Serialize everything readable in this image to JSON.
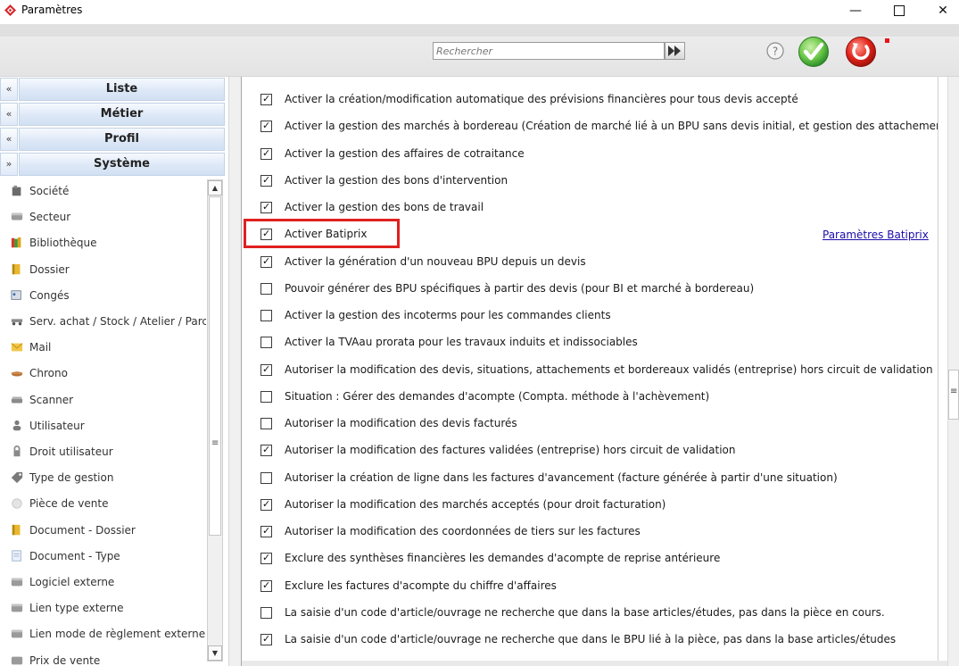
{
  "window": {
    "title": "Paramètres",
    "minimize_label": "—",
    "close_label": "✕"
  },
  "toolbar": {
    "search_placeholder": "Rechercher"
  },
  "sidebar": {
    "sections": [
      {
        "label": "Liste",
        "toggle": "«"
      },
      {
        "label": "Métier",
        "toggle": "«"
      },
      {
        "label": "Profil",
        "toggle": "«"
      },
      {
        "label": "Système",
        "toggle": "»"
      }
    ],
    "items": [
      {
        "label": "Société",
        "icon": "building-icon"
      },
      {
        "label": "Secteur",
        "icon": "sector-icon"
      },
      {
        "label": "Bibliothèque",
        "icon": "books-icon"
      },
      {
        "label": "Dossier",
        "icon": "folder-icon"
      },
      {
        "label": "Congés",
        "icon": "calendar-icon"
      },
      {
        "label": "Serv. achat / Stock / Atelier / Parc",
        "icon": "truck-icon"
      },
      {
        "label": "Mail",
        "icon": "mail-icon"
      },
      {
        "label": "Chrono",
        "icon": "chrono-icon"
      },
      {
        "label": "Scanner",
        "icon": "scanner-icon"
      },
      {
        "label": "Utilisateur",
        "icon": "user-icon"
      },
      {
        "label": "Droit utilisateur",
        "icon": "lock-icon"
      },
      {
        "label": "Type de gestion",
        "icon": "tag-icon"
      },
      {
        "label": "Pièce de vente",
        "icon": "coin-icon"
      },
      {
        "label": "Document - Dossier",
        "icon": "folder-document-icon"
      },
      {
        "label": "Document - Type",
        "icon": "document-icon"
      },
      {
        "label": "Logiciel externe",
        "icon": "external-software-icon"
      },
      {
        "label": "Lien type externe",
        "icon": "external-link-icon"
      },
      {
        "label": "Lien mode de règlement externe",
        "icon": "payment-link-icon"
      },
      {
        "label": "Prix de vente",
        "icon": "price-icon"
      }
    ]
  },
  "options": [
    {
      "label": "Activer la création/modification automatique des prévisions financières pour tous devis accepté",
      "checked": true
    },
    {
      "label": "Activer la gestion des marchés à bordereau (Création de marché lié à un BPU sans devis initial, et gestion des attachements)",
      "checked": true
    },
    {
      "label": "Activer la gestion des affaires de cotraitance",
      "checked": true
    },
    {
      "label": "Activer la gestion des bons d'intervention",
      "checked": true
    },
    {
      "label": "Activer la gestion des bons de travail",
      "checked": true
    },
    {
      "label": "Activer Batiprix",
      "checked": true
    },
    {
      "label": "Activer la génération d'un nouveau BPU depuis un devis",
      "checked": true
    },
    {
      "label": "Pouvoir générer des BPU spécifiques à partir des devis (pour BI et marché à bordereau)",
      "checked": false
    },
    {
      "label": "Activer la gestion des incoterms pour les commandes clients",
      "checked": false
    },
    {
      "label": "Activer la TVAau prorata pour les travaux induits et indissociables",
      "checked": false
    },
    {
      "label": "Autoriser la modification des devis, situations, attachements et bordereaux validés (entreprise) hors circuit de validation",
      "checked": true
    },
    {
      "label": "Situation : Gérer des demandes d'acompte (Compta. méthode à l'achèvement)",
      "checked": false
    },
    {
      "label": "Autoriser la modification des devis facturés",
      "checked": false
    },
    {
      "label": "Autoriser la modification des factures validées (entreprise) hors circuit de validation",
      "checked": true
    },
    {
      "label": "Autoriser la création de ligne dans les factures d'avancement (facture générée à partir d'une situation)",
      "checked": false
    },
    {
      "label": "Autoriser la modification des marchés acceptés (pour droit facturation)",
      "checked": true
    },
    {
      "label": "Autoriser la modification des coordonnées de tiers sur les factures",
      "checked": true
    },
    {
      "label": "Exclure des synthèses financières les demandes d'acompte de reprise antérieure",
      "checked": true
    },
    {
      "label": "Exclure les factures d'acompte du chiffre d'affaires",
      "checked": true
    },
    {
      "label": "La saisie d'un code d'article/ouvrage ne recherche que dans la base articles/études, pas dans la pièce en cours.",
      "checked": false
    },
    {
      "label": "La saisie d'un code d'article/ouvrage ne recherche que dans le BPU lié à la pièce, pas dans la base articles/études",
      "checked": true
    }
  ],
  "batiprix_link": "Paramètres Batiprix",
  "colors": {
    "accent_red": "#e02020",
    "link": "#1a0dab",
    "ok_green": "#3aa83a"
  }
}
